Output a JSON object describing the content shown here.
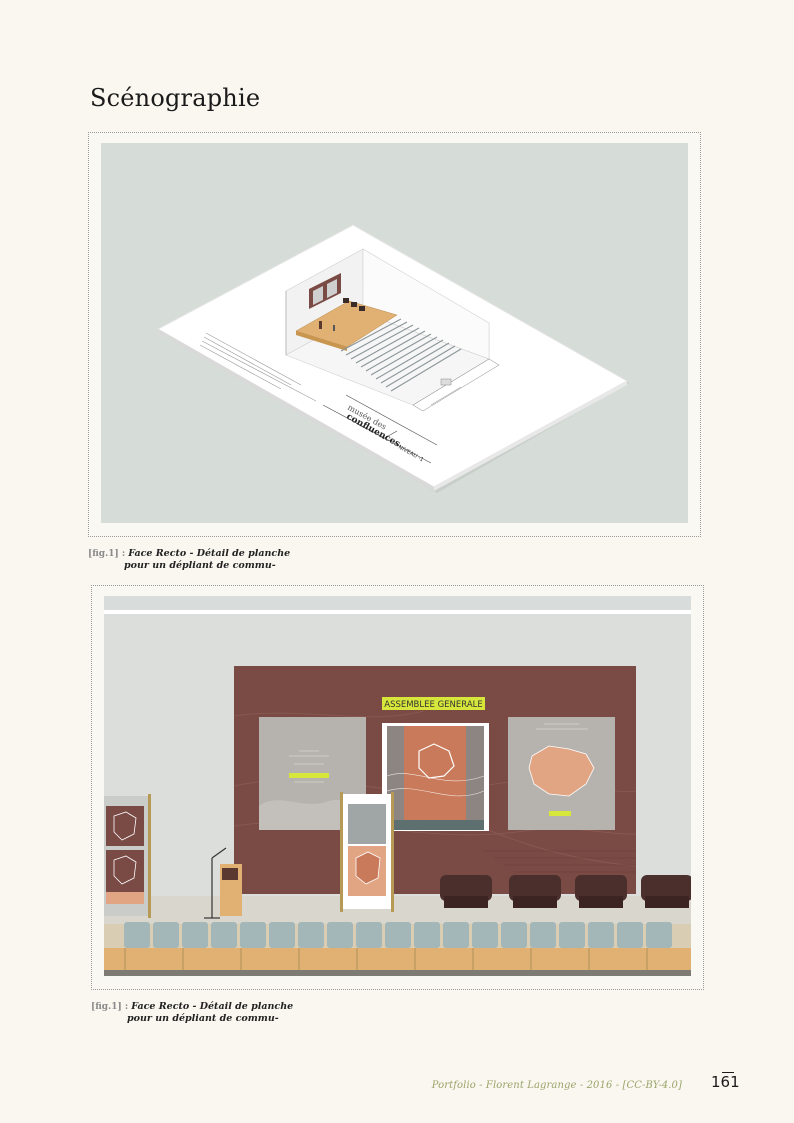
{
  "page": {
    "title": "Scénographie",
    "page_number": "161",
    "footer": "Portfolio - Florent Lagrange - 2016 - [CC-BY-4.0]"
  },
  "figures": [
    {
      "label": "[fig.1] :",
      "caption_line1": "Face Recto - Détail de planche",
      "caption_line2": "pour un dépliant de commu-",
      "board_title_line1": "musée des",
      "board_title_line2": "confluences",
      "board_level": "NIVEAU -1"
    },
    {
      "label": "[fig.1] :",
      "caption_line1": "Face Recto - Détail de planche",
      "caption_line2": "pour un dépliant de commu-",
      "banner_text": "ASSEMBLEE GENERALE"
    }
  ],
  "colors": {
    "background": "#f9f7f0",
    "backdrop_brown": "#7a4a45",
    "banner_yellow": "#d6e63a",
    "wood": "#e0b173",
    "seat_blue": "#9fb3b4",
    "footer_green": "#9aa46a"
  }
}
